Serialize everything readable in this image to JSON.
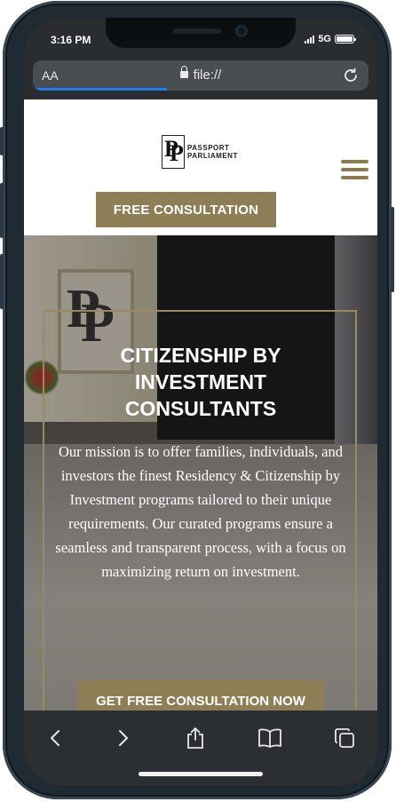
{
  "status": {
    "time": "3:16 PM",
    "network": "5G"
  },
  "browser": {
    "text_size_label": "AA",
    "url": "file://",
    "load_progress": 0.4
  },
  "site": {
    "logo_text_line1": "PASSPORT",
    "logo_text_line2": "PARLIAMENT",
    "logo_mark": "PP",
    "header_cta": "FREE CONSULTATION",
    "hero_title": "CITIZENSHIP BY INVESTMENT CONSULTANTS",
    "hero_text": "Our mission is to offer families, individuals, and investors the finest Residency & Citizenship by Investment programs tailored to their unique requirements. Our curated programs ensure a seamless and transparent process, with a focus on maximizing return on investment.",
    "hero_cta": "GET FREE CONSULTATION NOW"
  },
  "toolbar": {
    "icons": [
      "back-icon",
      "forward-icon",
      "share-icon",
      "bookmarks-icon",
      "tabs-icon"
    ]
  },
  "colors": {
    "gold": "#8e7e55",
    "progress": "#1e7bf2"
  }
}
